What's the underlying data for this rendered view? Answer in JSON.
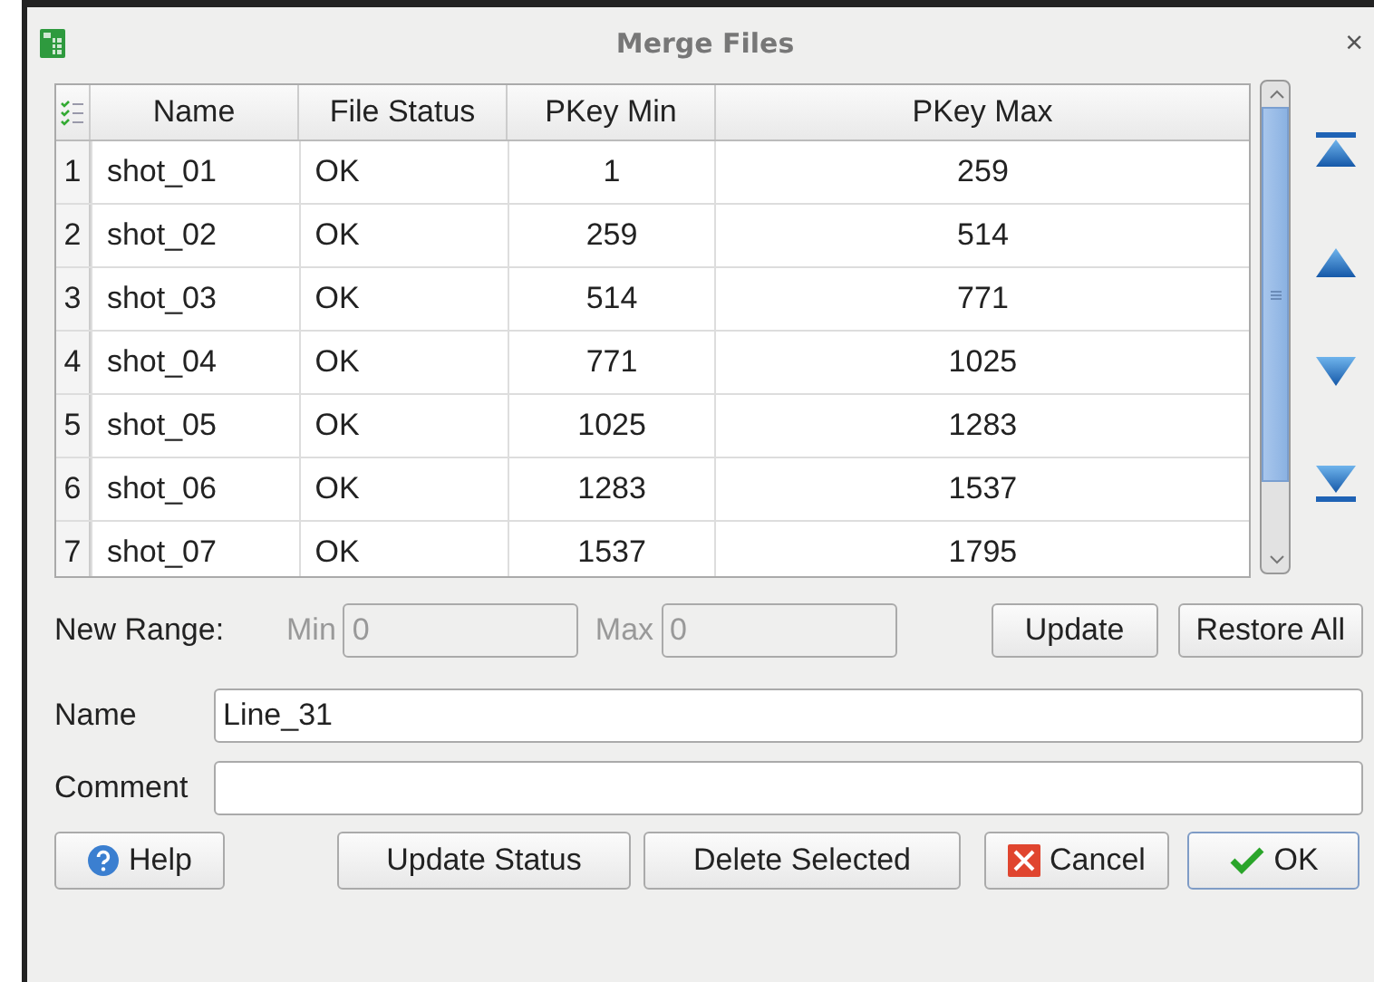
{
  "window": {
    "title": "Merge Files",
    "close": "×"
  },
  "table": {
    "columns": [
      "Name",
      "File Status",
      "PKey Min",
      "PKey Max"
    ],
    "rows": [
      {
        "index": "1",
        "cells": [
          "shot_01",
          "OK",
          "1",
          "259"
        ]
      },
      {
        "index": "2",
        "cells": [
          "shot_02",
          "OK",
          "259",
          "514"
        ]
      },
      {
        "index": "3",
        "cells": [
          "shot_03",
          "OK",
          "514",
          "771"
        ]
      },
      {
        "index": "4",
        "cells": [
          "shot_04",
          "OK",
          "771",
          "1025"
        ]
      },
      {
        "index": "5",
        "cells": [
          "shot_05",
          "OK",
          "1025",
          "1283"
        ]
      },
      {
        "index": "6",
        "cells": [
          "shot_06",
          "OK",
          "1283",
          "1537"
        ]
      },
      {
        "index": "7",
        "cells": [
          "shot_07",
          "OK",
          "1537",
          "1795"
        ]
      }
    ]
  },
  "new_range": {
    "label": "New Range:",
    "min": {
      "label": "Min",
      "value": "0",
      "disabled": true
    },
    "max": {
      "label": "Max",
      "value": "0",
      "disabled": true
    },
    "buttons": [
      "Update",
      "Restore All"
    ]
  },
  "name": {
    "label": "Name",
    "value": "Line_31"
  },
  "comment": {
    "label": "Comment"
  },
  "buttons": [
    {
      "kind": "help",
      "label": "Help"
    },
    {
      "kind": "plain",
      "label": "Update Status"
    },
    {
      "kind": "plain",
      "label": "Delete Selected"
    },
    {
      "kind": "cancel",
      "label": "Cancel"
    },
    {
      "kind": "ok",
      "label": "OK"
    }
  ]
}
